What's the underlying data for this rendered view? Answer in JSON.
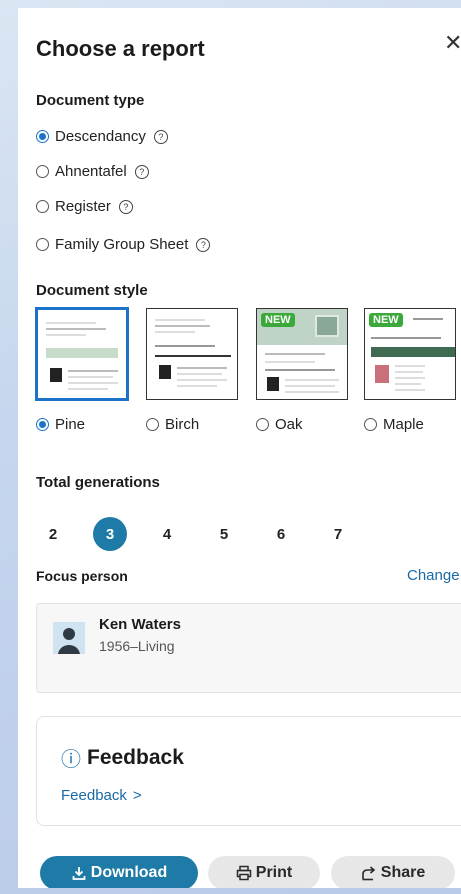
{
  "dialog": {
    "title": "Choose a report",
    "close_glyph": "✕"
  },
  "document_type": {
    "label": "Document type",
    "options": [
      {
        "label": "Descendancy",
        "selected": true,
        "help": "?"
      },
      {
        "label": "Ahnentafel",
        "selected": false,
        "help": "?"
      },
      {
        "label": "Register",
        "selected": false,
        "help": "?"
      },
      {
        "label": "Family Group Sheet",
        "selected": false,
        "help": "?"
      }
    ]
  },
  "document_style": {
    "label": "Document style",
    "options": [
      {
        "label": "Pine",
        "selected": true,
        "new": false
      },
      {
        "label": "Birch",
        "selected": false,
        "new": false
      },
      {
        "label": "Oak",
        "selected": false,
        "new": true
      },
      {
        "label": "Maple",
        "selected": false,
        "new": true
      }
    ],
    "new_badge": "NEW"
  },
  "generations": {
    "label": "Total generations",
    "options": [
      "2",
      "3",
      "4",
      "5",
      "6",
      "7"
    ],
    "selected": "3"
  },
  "focus_person": {
    "label": "Focus person",
    "change_link": "Change",
    "name": "Ken Waters",
    "dates": "1956–Living"
  },
  "feedback": {
    "icon": "ⓘ",
    "title": "Feedback",
    "link": "Feedback",
    "chevron": ">"
  },
  "actions": {
    "download": "Download",
    "print": "Print",
    "share": "Share"
  },
  "colors": {
    "accent": "#1e7aa6",
    "radio": "#1a73c8",
    "new_badge": "#3aa93a"
  }
}
